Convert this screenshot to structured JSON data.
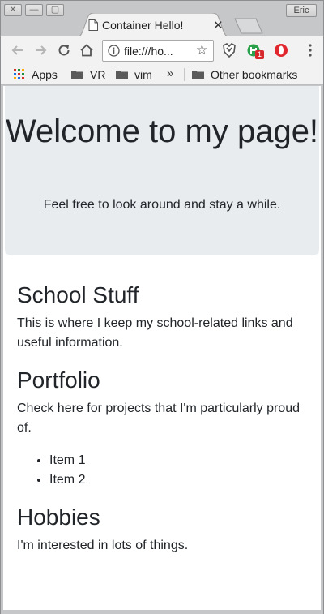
{
  "window": {
    "profile_name": "Eric",
    "controls": {
      "close": "✕",
      "minimize": "—",
      "maximize": "▢"
    }
  },
  "tab": {
    "title": "Container Hello!",
    "close_glyph": "✕"
  },
  "toolbar": {
    "back_glyph": "←",
    "forward_glyph": "→",
    "reload_glyph": "↻",
    "url": "file:///ho...",
    "star_glyph": "☆"
  },
  "extensions": {
    "badge_count": "1"
  },
  "bookmarks": {
    "items": [
      {
        "label": "Apps"
      },
      {
        "label": "VR"
      },
      {
        "label": "vim"
      }
    ],
    "overflow_glyph": "»",
    "other_label": "Other bookmarks"
  },
  "page": {
    "jumbotron": {
      "heading": "Welcome to my page!",
      "subtitle": "Feel free to look around and stay a while."
    },
    "sections": [
      {
        "heading": "School Stuff",
        "body": "This is where I keep my school-related links and useful information."
      },
      {
        "heading": "Portfolio",
        "body": "Check here for projects that I'm particularly proud of.",
        "items": [
          "Item 1",
          "Item 2"
        ]
      },
      {
        "heading": "Hobbies",
        "body": "I'm interested in lots of things."
      }
    ]
  },
  "colors": {
    "jumbotron_bg": "#e9ecef",
    "text": "#212529",
    "chrome_bg": "#f2f2f2"
  }
}
